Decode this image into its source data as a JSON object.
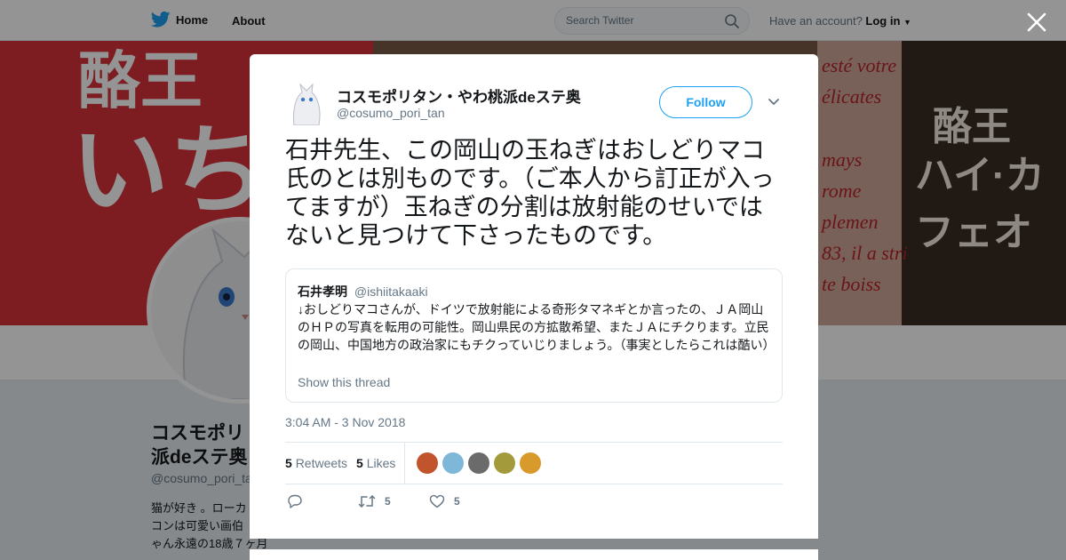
{
  "topnav": {
    "home_label": "Home",
    "about_label": "About",
    "search_placeholder": "Search Twitter",
    "account_prompt": "Have an account?",
    "login_label": "Log in"
  },
  "banner": {
    "text_top": "酪王",
    "text_big": "いち",
    "text_right_1": "酪王",
    "text_right_2": "ハイ·カフェオ",
    "text_french": "esté votre\nélicates\n\nmays\nrome\nplemen\n83, il a stri\nte boiss"
  },
  "profile": {
    "name": "コスモポリ\n派deステ奥",
    "handle": "@cosumo_pori_ta",
    "bio": "猫が好き 。ローカ\nコンは可愛い画伯\nゃん永遠の18歳７ヶ月"
  },
  "tweet": {
    "author_name": "コスモポリタン・やわ桃派deステ奥",
    "author_handle": "@cosumo_pori_tan",
    "follow_label": "Follow",
    "text": "石井先生、この岡山の玉ねぎはおしどりマコ氏のとは別ものです。（ご本人から訂正が入ってますが）玉ねぎの分割は放射能のせいではないと見つけて下さったものです。",
    "quote": {
      "name": "石井孝明",
      "handle": "@ishiitakaaki",
      "text": "↓おしどりマコさんが、ドイツで放射能による奇形タマネギとか言ったの、ＪＡ岡山のＨＰの写真を転用の可能性。岡山県民の方拡散希望、またＪＡにチクります。立民の岡山、中国地方の政治家にもチクっていじりましょう。（事実としたらこれは酷い）",
      "thread_label": "Show this thread"
    },
    "timestamp": "3:04 AM - 3 Nov 2018",
    "retweets_count": "5",
    "retweets_label": "Retweets",
    "likes_count": "5",
    "likes_label": "Likes",
    "liker_colors": [
      "#c2542d",
      "#7fb7d8",
      "#6b6b6b",
      "#a39a3c",
      "#d89a2b"
    ],
    "action_retweet_count": "5",
    "action_like_count": "5"
  },
  "colors": {
    "accent": "#1da1f2",
    "text": "#14171a",
    "muted": "#657786",
    "border": "#e1e8ed"
  }
}
